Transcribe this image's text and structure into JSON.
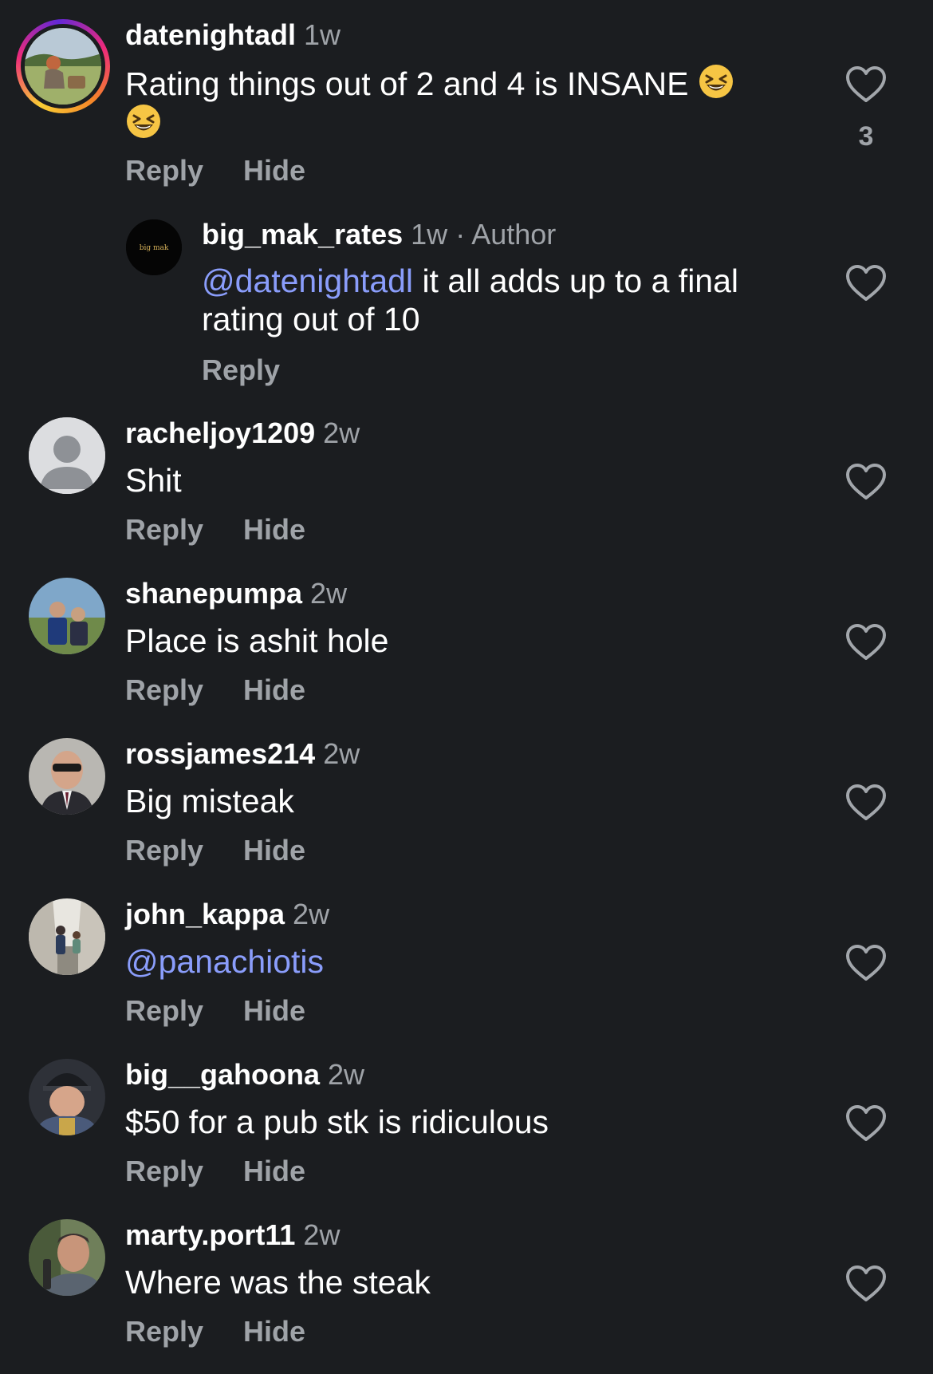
{
  "actions": {
    "reply_label": "Reply",
    "hide_label": "Hide"
  },
  "colors": {
    "background": "#1b1d20",
    "secondary_text": "#9fa3a8",
    "mention": "#8a9dfb"
  },
  "comments": [
    {
      "username": "datenightadl",
      "time": "1w",
      "text": "Rating things out of 2 and 4 is INSANE",
      "emoji": [
        "grinning-squinting-face",
        "grinning-squinting-face"
      ],
      "likes": "3",
      "avatar_icon": "story-ring-avatar"
    },
    {
      "username": "big_mak_rates",
      "time": "1w",
      "author_tag": "· Author",
      "mention": "@datenightadl",
      "text": " it all adds up to a final rating out of 10",
      "avatar_label": "big mak"
    },
    {
      "username": "racheljoy1209",
      "time": "2w",
      "text": "Shit",
      "avatar_icon": "default-user-icon"
    },
    {
      "username": "shanepumpa",
      "time": "2w",
      "text": "Place is ashit hole"
    },
    {
      "username": "rossjames214",
      "time": "2w",
      "text": "Big misteak"
    },
    {
      "username": "john_kappa",
      "time": "2w",
      "mention": "@panachiotis"
    },
    {
      "username": "big__gahoona",
      "time": "2w",
      "text": "$50 for a pub stk is ridiculous"
    },
    {
      "username": "marty.port11",
      "time": "2w",
      "text": "Where was the steak"
    }
  ]
}
